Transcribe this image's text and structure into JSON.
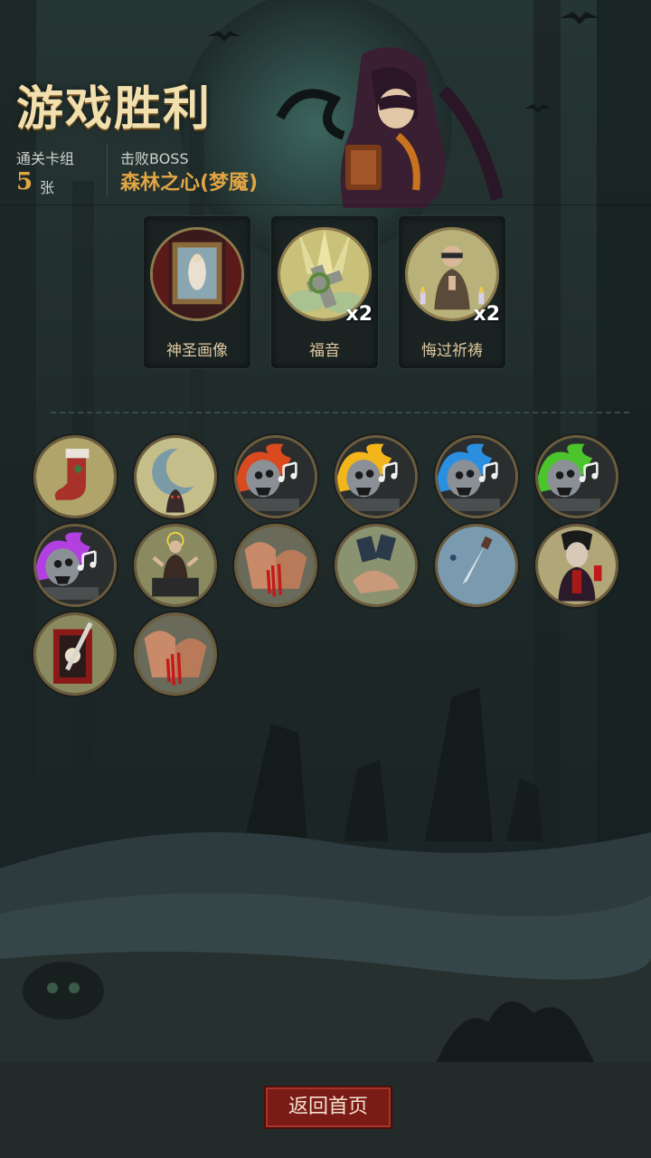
{
  "header": {
    "title": "游戏胜利",
    "deck_label": "通关卡组",
    "deck_count": "5",
    "deck_unit": "张",
    "boss_label": "击败BOSS",
    "boss_name": "森林之心(梦魇)"
  },
  "rewards": [
    {
      "label": "神圣画像",
      "icon": "holy-portrait-icon",
      "multiplier": ""
    },
    {
      "label": "福音",
      "icon": "gospel-cross-icon",
      "multiplier": "x2"
    },
    {
      "label": "悔过祈祷",
      "icon": "repentance-prayer-icon",
      "multiplier": "x2"
    }
  ],
  "cards": [
    {
      "icon": "christmas-stocking-icon",
      "fire": ""
    },
    {
      "icon": "crescent-moon-icon",
      "fire": ""
    },
    {
      "icon": "skull-music-red-icon",
      "fire": "#d94b1f"
    },
    {
      "icon": "skull-music-yellow-icon",
      "fire": "#f2b51c"
    },
    {
      "icon": "skull-music-blue-icon",
      "fire": "#2b8fe0"
    },
    {
      "icon": "skull-music-green-icon",
      "fire": "#4cc42c"
    },
    {
      "icon": "skull-music-purple-icon",
      "fire": "#b23fe0"
    },
    {
      "icon": "preacher-icon",
      "fire": ""
    },
    {
      "icon": "bleeding-hands-icon",
      "fire": ""
    },
    {
      "icon": "card-hand-icon",
      "fire": ""
    },
    {
      "icon": "dagger-icon",
      "fire": ""
    },
    {
      "icon": "vampire-icon",
      "fire": ""
    },
    {
      "icon": "skull-card-blade-icon",
      "fire": ""
    },
    {
      "icon": "bleeding-hands-icon",
      "fire": ""
    }
  ],
  "footer": {
    "home_button": "返回首页"
  },
  "colors": {
    "accent_gold": "#e2a544",
    "title_cream": "#f1dfae",
    "button_red": "#7a1b16"
  }
}
